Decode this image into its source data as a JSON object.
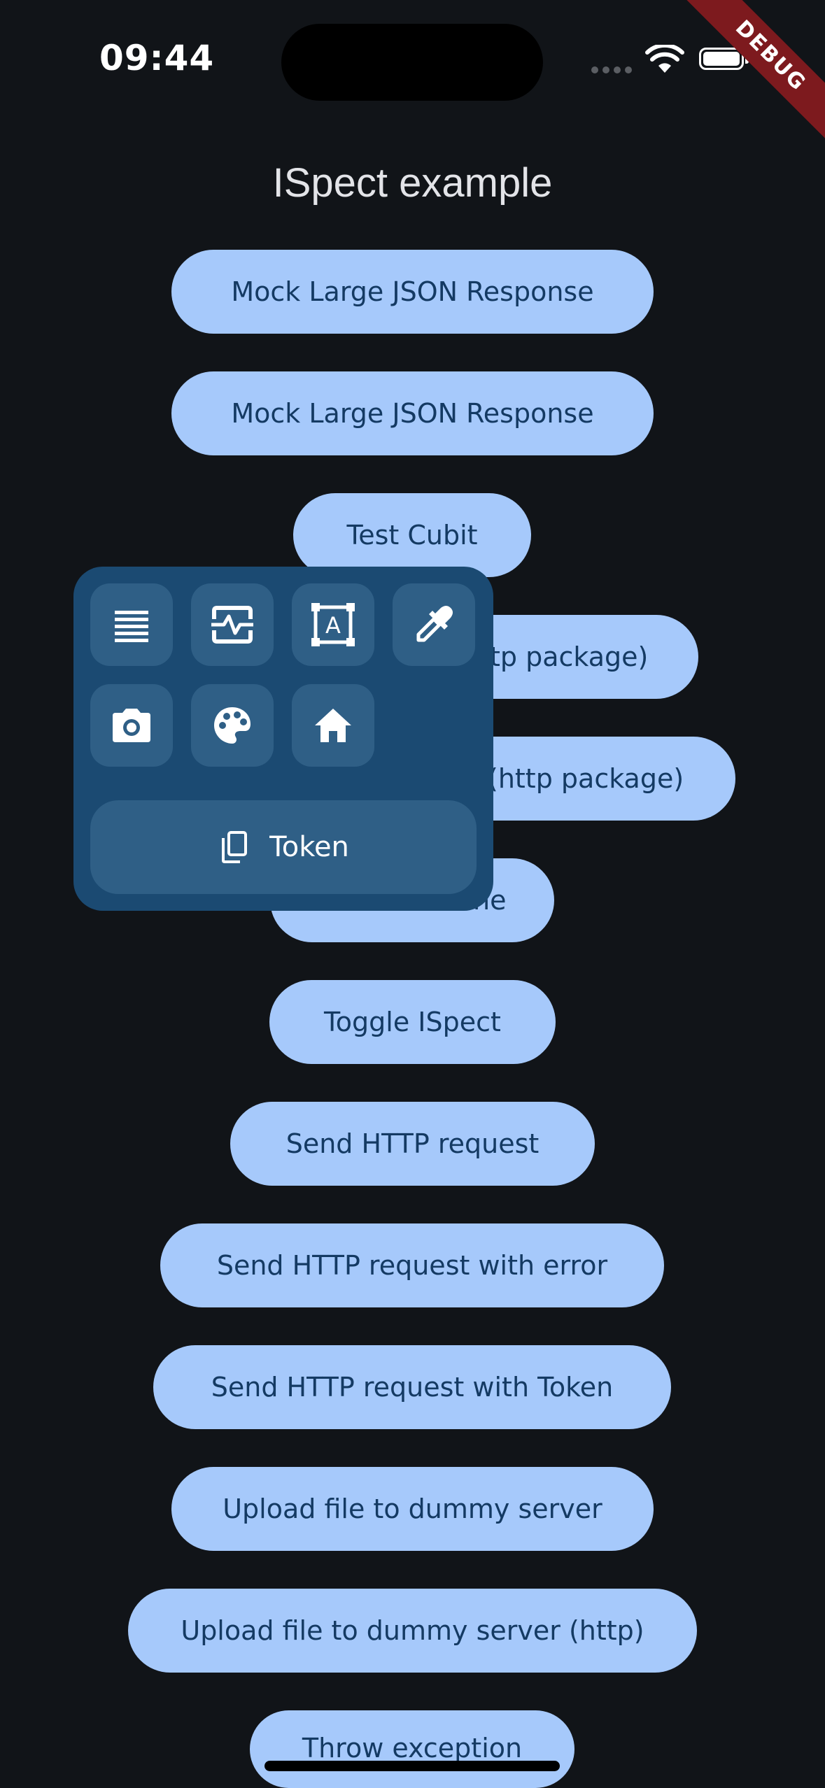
{
  "status_bar": {
    "time": "09:44"
  },
  "debug_banner": "DEBUG",
  "app": {
    "title": "ISpect example"
  },
  "buttons": [
    "Mock Large JSON Response",
    "Mock Large JSON Response",
    "Test Cubit",
    "Send HTTP request (http package)",
    "Send HTTP request with error (http package)",
    "Toggle theme",
    "Toggle ISpect",
    "Send HTTP request",
    "Send HTTP request with error",
    "Send HTTP request with Token",
    "Upload file to dummy server",
    "Upload file to dummy server (http)",
    "Throw exception"
  ],
  "visible_button_text": {
    "b3": "tp package)",
    "b4": "(http package)",
    "b5": "ne"
  },
  "inspector_panel": {
    "tools": [
      "logs-icon",
      "performance-icon",
      "layout-inspector-icon",
      "color-picker-icon",
      "screenshot-icon",
      "palette-icon",
      "home-icon"
    ],
    "token_label": "Token"
  },
  "colors": {
    "background": "#111418",
    "button": "#a6c9fb",
    "button_text": "#143a63",
    "panel": "#1b4a72",
    "panel_tile": "#2f5f86",
    "debug_ribbon": "#7d1a1e"
  }
}
